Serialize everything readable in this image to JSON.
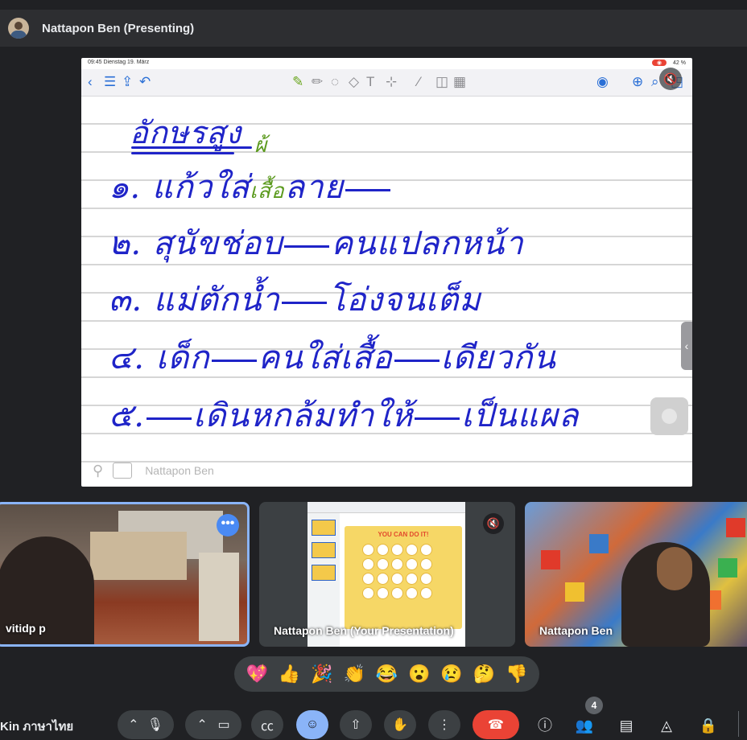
{
  "topbar": {
    "presenter_label": "Nattapon Ben (Presenting)"
  },
  "slide": {
    "status_left": "09:45  Dienstag 19. März",
    "status_right": "42 %",
    "title": "อักษรสูง",
    "lines": [
      {
        "num": "๑.",
        "before": "แก้วใส่",
        "green": "เสื้อ",
        "after": "ลาย"
      },
      {
        "num": "๒.",
        "before": "สุนัขช่อบ",
        "after": "คนแปลกหน้า"
      },
      {
        "num": "๓.",
        "before": "แม่ตักน้ำ",
        "after": "โอ่งจนเต็ม"
      },
      {
        "num": "๔.",
        "before": "เด็ก",
        "middle": "คนใส่เสื้อ",
        "after": "เดียวกัน"
      },
      {
        "num": "๕.",
        "before": "",
        "middle": "เดินหกล้มทำให้",
        "after": "เป็นแผล"
      }
    ],
    "annotation": "ผ้",
    "footer_name": "Nattapon Ben"
  },
  "tiles": [
    {
      "name": "vitidp p"
    },
    {
      "name": "Nattapon Ben (Your Presentation)",
      "thumb_heading": "YOU CAN DO IT!"
    },
    {
      "name": "Nattapon Ben"
    }
  ],
  "reactions": [
    "💖",
    "👍",
    "🎉",
    "👏",
    "😂",
    "😮",
    "😢",
    "🤔",
    "👎"
  ],
  "controls": {
    "meeting_title": "Kin ภาษาไทย",
    "people_count": "4"
  },
  "icons": {
    "mic": "mic-icon",
    "camera": "camera-icon",
    "captions": "captions-icon",
    "emoji": "emoji-icon",
    "present": "present-icon",
    "hand": "raise-hand-icon",
    "more": "more-options-icon",
    "hangup": "hangup-icon",
    "info": "info-icon",
    "people": "people-icon",
    "chat": "chat-icon",
    "activities": "activities-icon",
    "host": "host-controls-icon"
  },
  "colors": {
    "background": "#202124",
    "ink_blue": "#1f24c8",
    "ink_green": "#5b9a1e",
    "active_tile": "#8ab4f8",
    "hangup": "#ea4335"
  }
}
